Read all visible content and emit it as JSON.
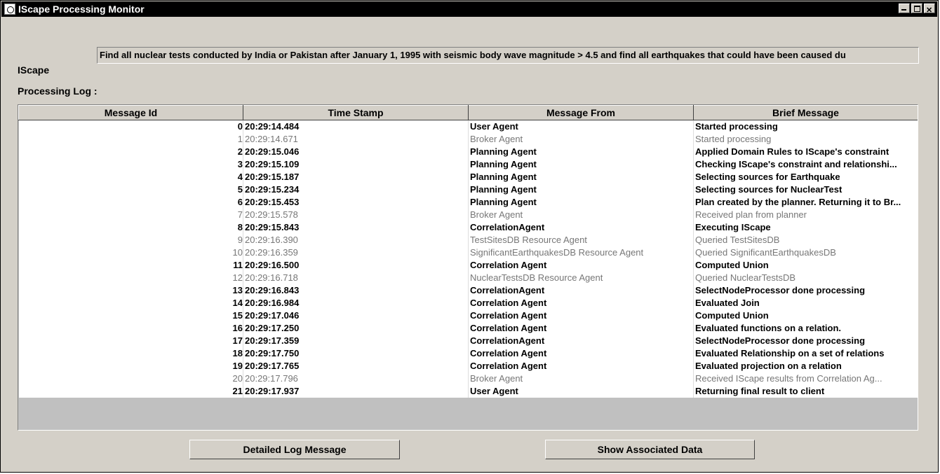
{
  "window": {
    "title": "IScape Processing Monitor"
  },
  "iscape": {
    "label": "IScape",
    "query": "Find all nuclear tests conducted by India or Pakistan after January 1, 1995 with seismic body wave magnitude > 4.5 and find all earthquakes that could have been caused du"
  },
  "log": {
    "label": "Processing Log :",
    "headers": [
      "Message Id",
      "Time Stamp",
      "Message From",
      "Brief Message"
    ],
    "rows": [
      {
        "id": "0",
        "time": "20:29:14.484",
        "from": "User Agent",
        "msg": "Started processing",
        "muted": false
      },
      {
        "id": "1",
        "time": "20:29:14.671",
        "from": "Broker Agent",
        "msg": "Started processing",
        "muted": true
      },
      {
        "id": "2",
        "time": "20:29:15.046",
        "from": "Planning Agent",
        "msg": "Applied Domain Rules to IScape's constraint",
        "muted": false
      },
      {
        "id": "3",
        "time": "20:29:15.109",
        "from": "Planning Agent",
        "msg": "Checking IScape's constraint and relationshi...",
        "muted": false
      },
      {
        "id": "4",
        "time": "20:29:15.187",
        "from": "Planning Agent",
        "msg": "Selecting sources for Earthquake",
        "muted": false
      },
      {
        "id": "5",
        "time": "20:29:15.234",
        "from": "Planning Agent",
        "msg": "Selecting sources for NuclearTest",
        "muted": false
      },
      {
        "id": "6",
        "time": "20:29:15.453",
        "from": "Planning Agent",
        "msg": "Plan created by the planner. Returning it to Br...",
        "muted": false
      },
      {
        "id": "7",
        "time": "20:29:15.578",
        "from": "Broker Agent",
        "msg": "Received plan from planner",
        "muted": true
      },
      {
        "id": "8",
        "time": "20:29:15.843",
        "from": "CorrelationAgent",
        "msg": "Executing IScape",
        "muted": false
      },
      {
        "id": "9",
        "time": "20:29:16.390",
        "from": "TestSitesDB Resource Agent",
        "msg": "Queried TestSitesDB",
        "muted": true
      },
      {
        "id": "10",
        "time": "20:29:16.359",
        "from": "SignificantEarthquakesDB Resource Agent",
        "msg": "Queried SignificantEarthquakesDB",
        "muted": true
      },
      {
        "id": "11",
        "time": "20:29:16.500",
        "from": "Correlation Agent",
        "msg": "Computed Union",
        "muted": false
      },
      {
        "id": "12",
        "time": "20:29:16.718",
        "from": "NuclearTestsDB Resource Agent",
        "msg": "Queried NuclearTestsDB",
        "muted": true
      },
      {
        "id": "13",
        "time": "20:29:16.843",
        "from": "CorrelationAgent",
        "msg": "SelectNodeProcessor done processing",
        "muted": false
      },
      {
        "id": "14",
        "time": "20:29:16.984",
        "from": "Correlation Agent",
        "msg": "Evaluated Join",
        "muted": false
      },
      {
        "id": "15",
        "time": "20:29:17.046",
        "from": "Correlation Agent",
        "msg": "Computed Union",
        "muted": false
      },
      {
        "id": "16",
        "time": "20:29:17.250",
        "from": "Correlation Agent",
        "msg": "Evaluated functions on a relation.",
        "muted": false
      },
      {
        "id": "17",
        "time": "20:29:17.359",
        "from": "CorrelationAgent",
        "msg": "SelectNodeProcessor done processing",
        "muted": false
      },
      {
        "id": "18",
        "time": "20:29:17.750",
        "from": "Correlation Agent",
        "msg": "Evaluated Relationship on a set of relations",
        "muted": false
      },
      {
        "id": "19",
        "time": "20:29:17.765",
        "from": "Correlation Agent",
        "msg": "Evaluated projection on a relation",
        "muted": false
      },
      {
        "id": "20",
        "time": "20:29:17.796",
        "from": "Broker Agent",
        "msg": "Received IScape results from Correlation Ag...",
        "muted": true
      },
      {
        "id": "21",
        "time": "20:29:17.937",
        "from": "User Agent",
        "msg": "Returning final result to client",
        "muted": false
      }
    ]
  },
  "buttons": {
    "detailed": "Detailed Log Message",
    "associated": "Show Associated Data"
  }
}
